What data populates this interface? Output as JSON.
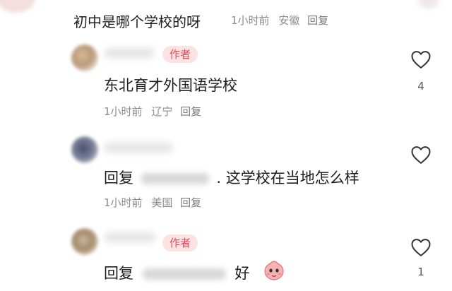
{
  "top_comment": {
    "text": "初中是哪个学校的呀",
    "time": "1小时前",
    "location": "安徽",
    "reply_label": "回复"
  },
  "comments": [
    {
      "author_badge": "作者",
      "text": "东北育才外国语学校",
      "time": "1小时前",
      "location": "辽宁",
      "reply_label": "回复",
      "like_count": "4"
    },
    {
      "reply_prefix": "回复",
      "text": ". 这学校在当地怎么样",
      "time": "1小时前",
      "location": "美国",
      "reply_label": "回复",
      "like_count": ""
    },
    {
      "author_badge": "作者",
      "reply_prefix": "回复",
      "text": "好",
      "like_count": "1"
    }
  ],
  "icons": {
    "like": "heart-outline-icon",
    "emoji": "pink-cartoon-emoji"
  }
}
